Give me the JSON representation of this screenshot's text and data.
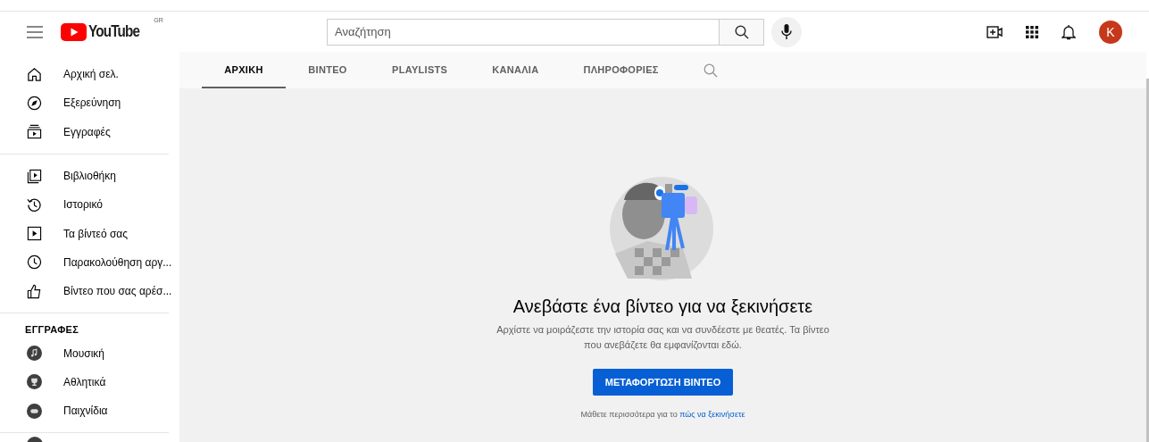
{
  "header": {
    "logo": "YouTube",
    "region": "GR",
    "search": {
      "placeholder": "Αναζήτηση"
    },
    "avatar": "K"
  },
  "sidebar": {
    "sections": [
      {
        "items": [
          {
            "label": "Αρχική σελ."
          },
          {
            "label": "Εξερεύνηση"
          },
          {
            "label": "Εγγραφές"
          }
        ]
      },
      {
        "items": [
          {
            "label": "Βιβλιοθήκη"
          },
          {
            "label": "Ιστορικό"
          },
          {
            "label": "Τα βίντεό σας"
          },
          {
            "label": "Παρακολούθηση αργ..."
          },
          {
            "label": "Βίντεο που σας αρέσ..."
          }
        ]
      },
      {
        "title": "ΕΓΓΡΑΦΕΣ",
        "items": [
          {
            "label": "Μουσική"
          },
          {
            "label": "Αθλητικά"
          },
          {
            "label": "Παιχνίδια"
          }
        ]
      }
    ]
  },
  "tabs": [
    {
      "label": "ΑΡΧΙΚΗ",
      "selected": true
    },
    {
      "label": "ΒΙΝΤΕΟ",
      "selected": false
    },
    {
      "label": "PLAYLISTS",
      "selected": false
    },
    {
      "label": "ΚΑΝΑΛΙΑ",
      "selected": false
    },
    {
      "label": "ΠΛΗΡΟΦΟΡΙΕΣ",
      "selected": false
    }
  ],
  "empty_state": {
    "title": "Ανεβάστε ένα βίντεο για να ξεκινήσετε",
    "text": "Αρχίστε να μοιράζεστε την ιστορία σας και να συνδέεστε με θεατές. Τα βίντεο που ανεβάζετε θα εμφανίζονται εδώ.",
    "button": "ΜΕΤΑΦΟΡΤΩΣΗ ΒΙΝΤΕΟ",
    "help_text": "Μάθετε περισσότερα για το",
    "help_link": "πώς να ξεκινήσετε"
  }
}
